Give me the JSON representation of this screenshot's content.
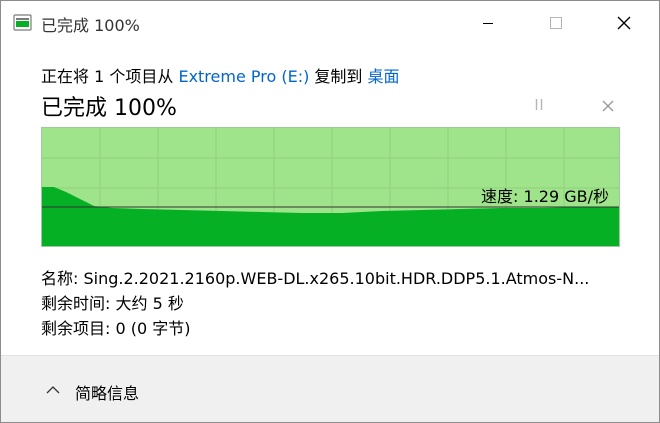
{
  "window": {
    "title": "已完成 100%"
  },
  "header": {
    "desc_prefix": "正在将 1 个项目从 ",
    "source": "Extreme Pro (E:)",
    "desc_middle": " 复制到 ",
    "destination": "桌面",
    "status": "已完成 100%"
  },
  "graph": {
    "speed_label": "速度: 1.29 GB/秒",
    "progress_fraction": 1.0,
    "colors": {
      "background": "#9fe38b",
      "fill": "#06b025",
      "grid": "#8fd07b"
    }
  },
  "details": {
    "name_label": "名称:",
    "name_value": "Sing.2.2021.2160p.WEB-DL.x265.10bit.HDR.DDP5.1.Atmos-N...",
    "time_label": "剩余时间:",
    "time_value": "大约 5 秒",
    "items_label": "剩余项目:",
    "items_value": "0 (0 字节)"
  },
  "footer": {
    "less_details_label": "简略信息"
  },
  "icons": {
    "title": "copy-progress-icon",
    "minimize": "minimize-icon",
    "maximize": "maximize-icon",
    "close": "close-icon",
    "pause": "pause-icon",
    "cancel": "cancel-icon",
    "chevron": "chevron-up-icon"
  }
}
